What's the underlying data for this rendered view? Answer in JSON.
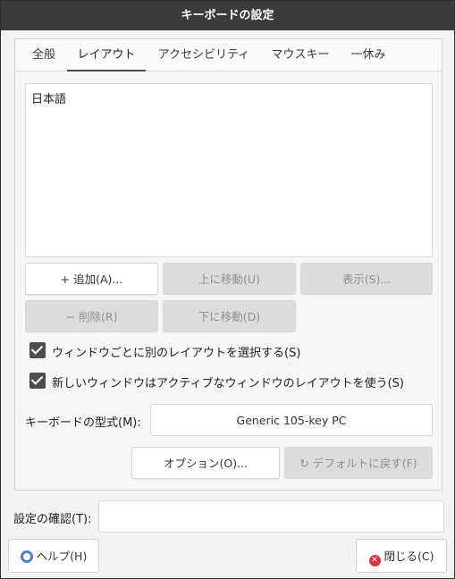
{
  "window": {
    "title": "キーボードの設定"
  },
  "tabs": [
    {
      "label": "全般",
      "active": false
    },
    {
      "label": "レイアウト",
      "active": true
    },
    {
      "label": "アクセシビリティ",
      "active": false
    },
    {
      "label": "マウスキー",
      "active": false
    },
    {
      "label": "一休み",
      "active": false
    }
  ],
  "layouts": [
    "日本語"
  ],
  "buttons": {
    "add": {
      "icon": "plus-icon",
      "glyph": "+",
      "label": "追加(A)...",
      "enabled": true
    },
    "move_up": {
      "label": "上に移動(U)",
      "enabled": false
    },
    "show": {
      "label": "表示(S)...",
      "enabled": false
    },
    "remove": {
      "icon": "minus-icon",
      "glyph": "−",
      "label": "削除(R)",
      "enabled": false
    },
    "move_down": {
      "label": "下に移動(D)",
      "enabled": false
    },
    "options": {
      "label": "オプション(O)...",
      "enabled": true
    },
    "reset": {
      "icon": "reset-icon",
      "glyph": "↻",
      "label": "デフォルトに戻す(F)",
      "enabled": false
    }
  },
  "checkboxes": {
    "per_window": {
      "label": "ウィンドウごとに別のレイアウトを選択する(S)",
      "checked": true
    },
    "new_window": {
      "label": "新しいウィンドウはアクティブなウィンドウのレイアウトを使う(S)",
      "checked": true
    }
  },
  "keyboard_model": {
    "label": "キーボードの型式(M):",
    "value": "Generic 105-key PC"
  },
  "test": {
    "label": "設定の確認(T):",
    "value": ""
  },
  "footer": {
    "help": {
      "icon": "help-icon",
      "label": "ヘルプ(H)"
    },
    "close": {
      "icon": "close-icon",
      "glyph": "✕",
      "label": "閉じる(C)"
    }
  },
  "colors": {
    "titlebar": "#3b3b3b",
    "checkbox": "#4d4d4d",
    "help_icon": "#4a7fd4",
    "close_icon": "#d9363e"
  }
}
